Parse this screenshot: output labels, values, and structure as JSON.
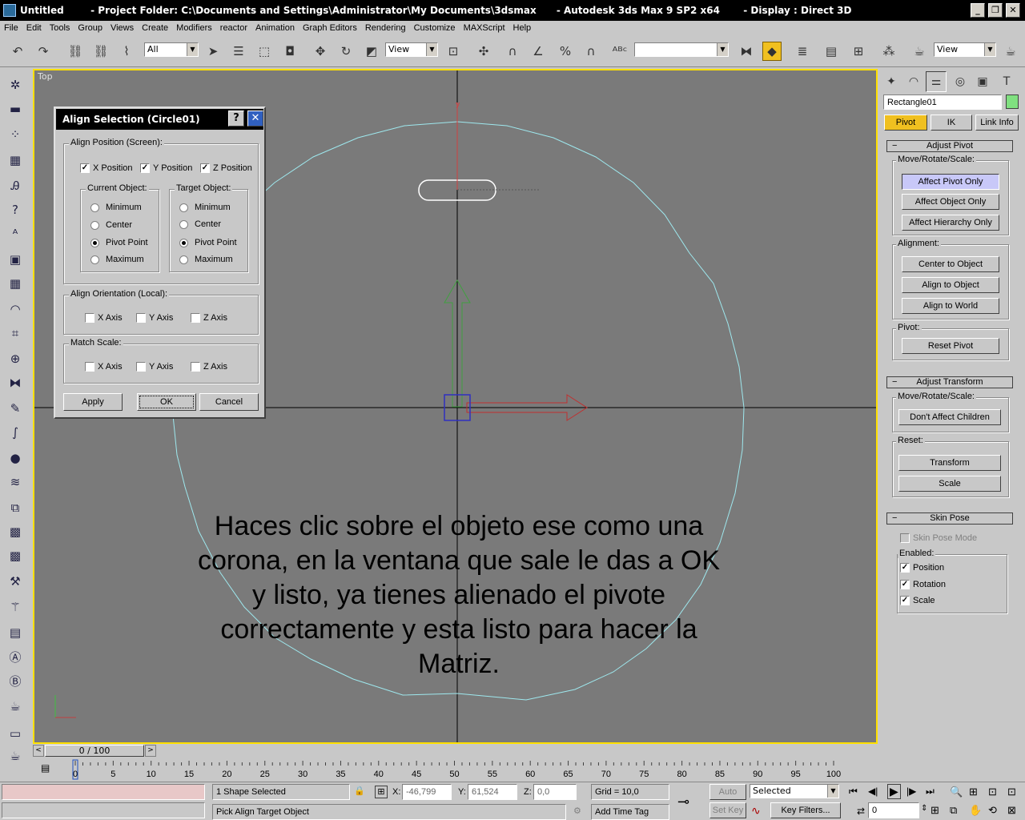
{
  "window": {
    "title": "Untitled        - Project Folder: C:\\Documents and Settings\\Administrator\\My Documents\\3dsmax      - Autodesk 3ds Max 9 SP2 x64       - Display : Direct 3D"
  },
  "menu": [
    "File",
    "Edit",
    "Tools",
    "Group",
    "Views",
    "Create",
    "Modifiers",
    "reactor",
    "Animation",
    "Graph Editors",
    "Rendering",
    "Customize",
    "MAXScript",
    "Help"
  ],
  "toolbar": {
    "selection_filter": "All",
    "ref_coord_1": "View",
    "ref_coord_2": "View",
    "named_selection": ""
  },
  "viewport": {
    "label": "Top",
    "overlay_text": "Haces clic sobre el objeto ese como una corona, en  la ventana que sale le das a OK y listo, ya tienes alienado el pivote correctamente y esta listo para hacer la Matriz."
  },
  "dialog": {
    "title": "Align Selection (Circle01)",
    "help_btn": "?",
    "close_btn": "✕",
    "align_position": {
      "label": "Align Position (Screen):",
      "x": "X Position",
      "y": "Y Position",
      "z": "Z Position",
      "x_checked": true,
      "y_checked": true,
      "z_checked": true
    },
    "current_object": {
      "label": "Current Object:",
      "options": [
        "Minimum",
        "Center",
        "Pivot Point",
        "Maximum"
      ],
      "selected": "Pivot Point"
    },
    "target_object": {
      "label": "Target Object:",
      "options": [
        "Minimum",
        "Center",
        "Pivot Point",
        "Maximum"
      ],
      "selected": "Pivot Point"
    },
    "align_orientation": {
      "label": "Align Orientation (Local):",
      "x": "X Axis",
      "y": "Y Axis",
      "z": "Z Axis"
    },
    "match_scale": {
      "label": "Match Scale:",
      "x": "X Axis",
      "y": "Y Axis",
      "z": "Z Axis"
    },
    "buttons": {
      "apply": "Apply",
      "ok": "OK",
      "cancel": "Cancel"
    }
  },
  "command_panel": {
    "object_name": "Rectangle01",
    "object_color": "#80e080",
    "hier_tabs": [
      "Pivot",
      "IK",
      "Link Info"
    ],
    "adjust_pivot": {
      "title": "Adjust Pivot",
      "move_label": "Move/Rotate/Scale:",
      "affect_pivot": "Affect Pivot Only",
      "affect_object": "Affect Object Only",
      "affect_hierarchy": "Affect Hierarchy Only",
      "alignment_label": "Alignment:",
      "center_to_object": "Center to Object",
      "align_to_object": "Align to Object",
      "align_to_world": "Align to World",
      "pivot_label": "Pivot:",
      "reset_pivot": "Reset Pivot"
    },
    "adjust_transform": {
      "title": "Adjust Transform",
      "move_label": "Move/Rotate/Scale:",
      "dont_affect_children": "Don't Affect Children",
      "reset_label": "Reset:",
      "transform": "Transform",
      "scale": "Scale"
    },
    "skin_pose": {
      "title": "Skin Pose",
      "mode": "Skin Pose Mode",
      "enabled_label": "Enabled:",
      "position": "Position",
      "rotation": "Rotation",
      "scale": "Scale"
    }
  },
  "timeline": {
    "slider_text": "0 / 100",
    "ticks": [
      "0",
      "5",
      "10",
      "15",
      "20",
      "25",
      "30",
      "35",
      "40",
      "45",
      "50",
      "55",
      "60",
      "65",
      "70",
      "75",
      "80",
      "85",
      "90",
      "95",
      "100"
    ]
  },
  "status": {
    "selection": "1 Shape Selected",
    "prompt": "Pick Align Target Object",
    "x_label": "X:",
    "x_value": "-46,799",
    "y_label": "Y:",
    "y_value": "61,524",
    "z_label": "Z:",
    "z_value": "0,0",
    "grid": "Grid = 10,0",
    "add_time_tag": "Add Time Tag",
    "auto_key": "Auto Key",
    "set_key": "Set Key",
    "key_mode": "Selected",
    "key_filters": "Key Filters...",
    "frame": "0"
  }
}
